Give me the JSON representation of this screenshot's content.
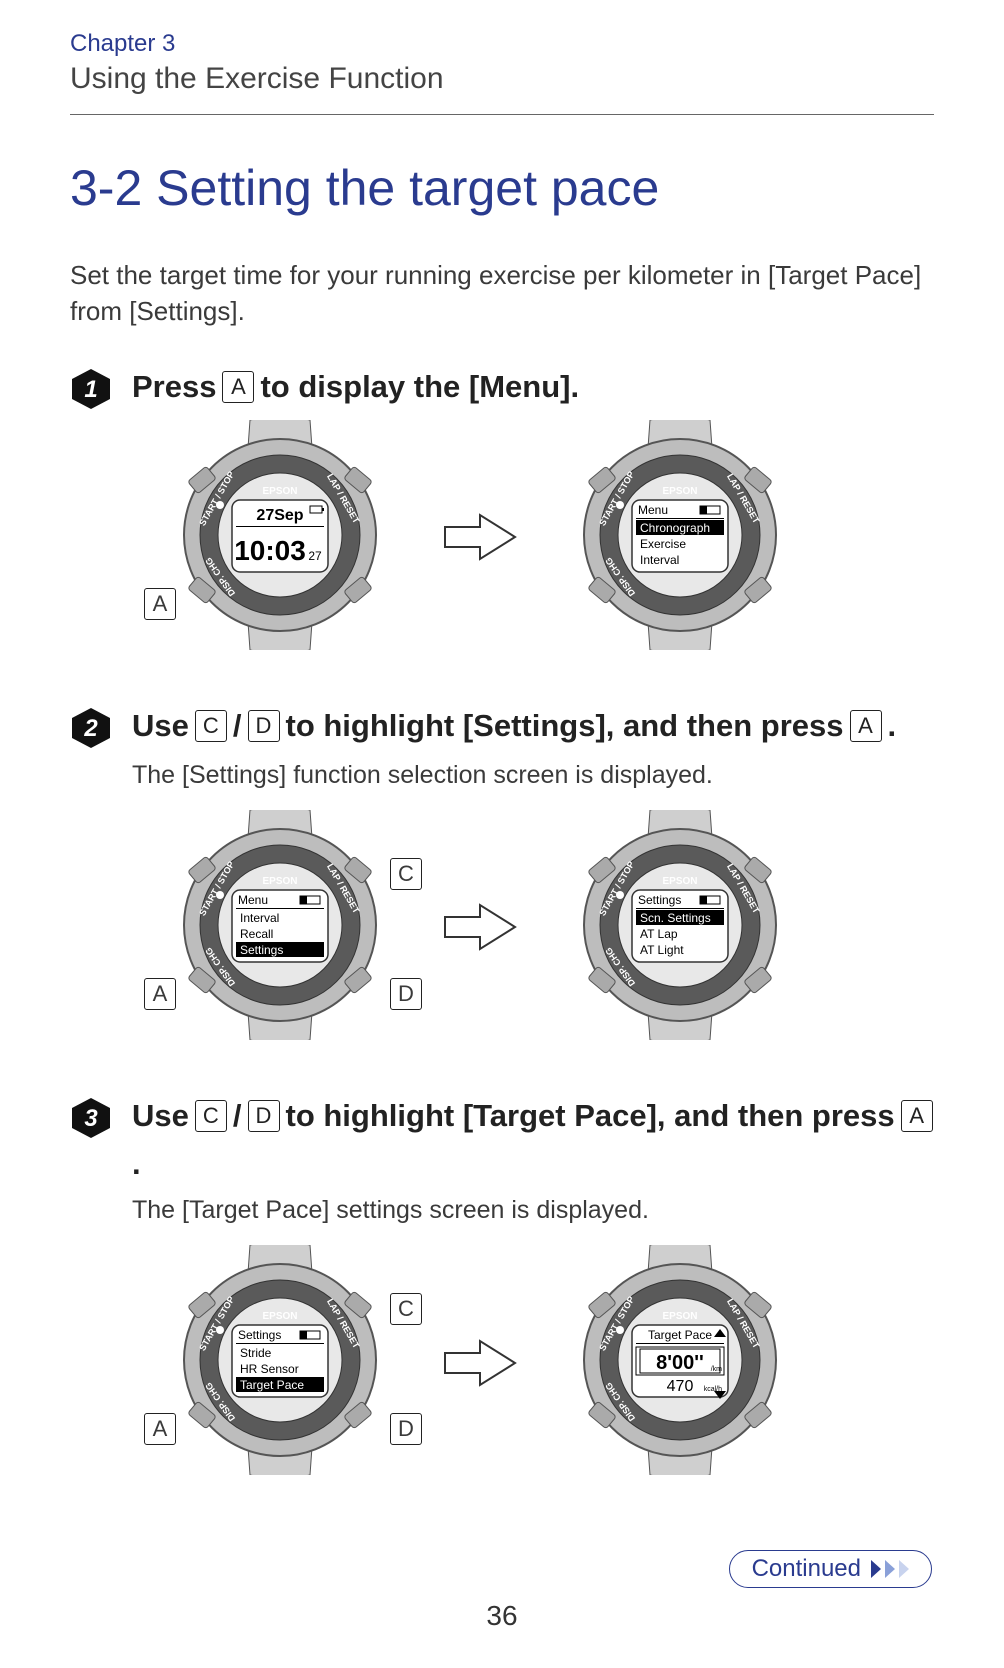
{
  "header": {
    "chapter": "Chapter 3",
    "subtitle": "Using the Exercise Function"
  },
  "section_title": "3-2 Setting the target pace",
  "intro": "Set the target time for your running exercise per kilometer in [Target Pace] from [Settings].",
  "keys": {
    "A": "A",
    "C": "C",
    "D": "D"
  },
  "steps": {
    "s1": {
      "num": 1,
      "pre": "Press ",
      "post": " to display the [Menu].",
      "watch_left": {
        "brand": "EPSON",
        "line1": "27Sep",
        "line2": "10:03",
        "line2_small": "27"
      },
      "watch_right": {
        "brand": "EPSON",
        "title": "Menu",
        "items": [
          "Chronograph",
          "Exercise",
          "Interval"
        ],
        "highlight_index": 0
      },
      "callouts": [
        "A"
      ]
    },
    "s2": {
      "num": 2,
      "parts": [
        "Use ",
        " / ",
        " to highlight [Settings], and then press ",
        "."
      ],
      "desc": "The [Settings] function selection screen is displayed.",
      "watch_left": {
        "brand": "EPSON",
        "title": "Menu",
        "items": [
          "Interval",
          "Recall",
          "Settings"
        ],
        "highlight_index": 2
      },
      "watch_right": {
        "brand": "EPSON",
        "title": "Settings",
        "items": [
          "Scn. Settings",
          "AT Lap",
          "AT Light"
        ],
        "highlight_index": 0
      },
      "callouts_left": [
        "A"
      ],
      "callouts_right": [
        "C",
        "D"
      ]
    },
    "s3": {
      "num": 3,
      "parts": [
        "Use ",
        " / ",
        " to highlight [Target Pace], and then press ",
        "."
      ],
      "desc": "The [Target Pace] settings screen is displayed.",
      "watch_left": {
        "brand": "EPSON",
        "title": "Settings",
        "items": [
          "Stride",
          "HR Sensor",
          "Target Pace"
        ],
        "highlight_index": 2
      },
      "watch_right": {
        "brand": "EPSON",
        "title": "Target Pace",
        "big_value": "8'00''",
        "big_unit": "/km",
        "sub_value": "470",
        "sub_unit": "kcal/h"
      },
      "callouts_left": [
        "A"
      ],
      "callouts_right": [
        "C",
        "D"
      ]
    }
  },
  "continued_label": "Continued",
  "page_number": "36"
}
